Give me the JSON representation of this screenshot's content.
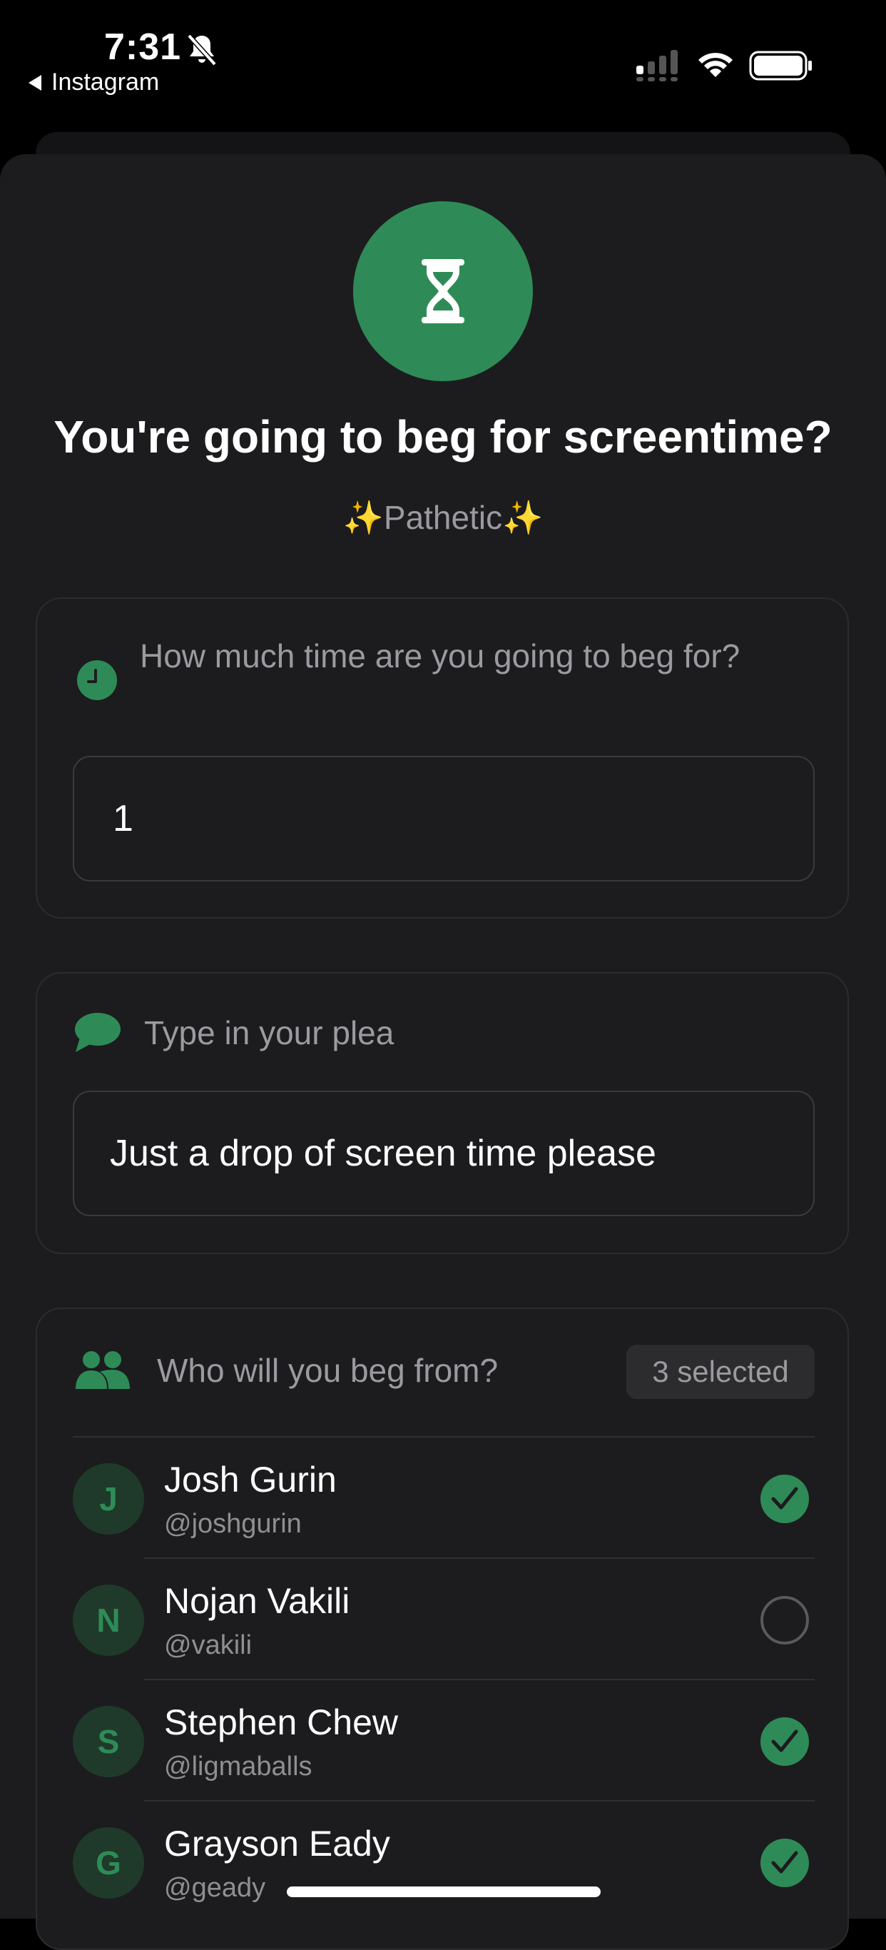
{
  "status_bar": {
    "time": "7:31",
    "back_app": "Instagram"
  },
  "header": {
    "title": "You're going to beg for screentime?",
    "subtitle_sparkle": "✨",
    "subtitle_text": "Pathetic"
  },
  "time_section": {
    "label": "How much time are you going to beg for?",
    "value": "1"
  },
  "plea_section": {
    "label": "Type in your plea",
    "value": "Just a drop of screen time please"
  },
  "recipients_section": {
    "label": "Who will you beg from?",
    "selected_count": "3 selected",
    "contacts": [
      {
        "initial": "J",
        "name": "Josh Gurin",
        "handle": "@joshgurin",
        "selected": true
      },
      {
        "initial": "N",
        "name": "Nojan Vakili",
        "handle": "@vakili",
        "selected": false
      },
      {
        "initial": "S",
        "name": "Stephen Chew",
        "handle": "@ligmaballs",
        "selected": true
      },
      {
        "initial": "G",
        "name": "Grayson Eady",
        "handle": "@geady",
        "selected": true
      }
    ]
  },
  "colors": {
    "accent": "#2e8b57",
    "background": "#1c1c1e",
    "muted_text": "#9a9aa0"
  },
  "icons": {
    "hero": "hourglass-icon",
    "time": "clock-icon",
    "plea": "chat-bubble-icon",
    "recipients": "people-icon",
    "selected": "checkmark-icon"
  }
}
